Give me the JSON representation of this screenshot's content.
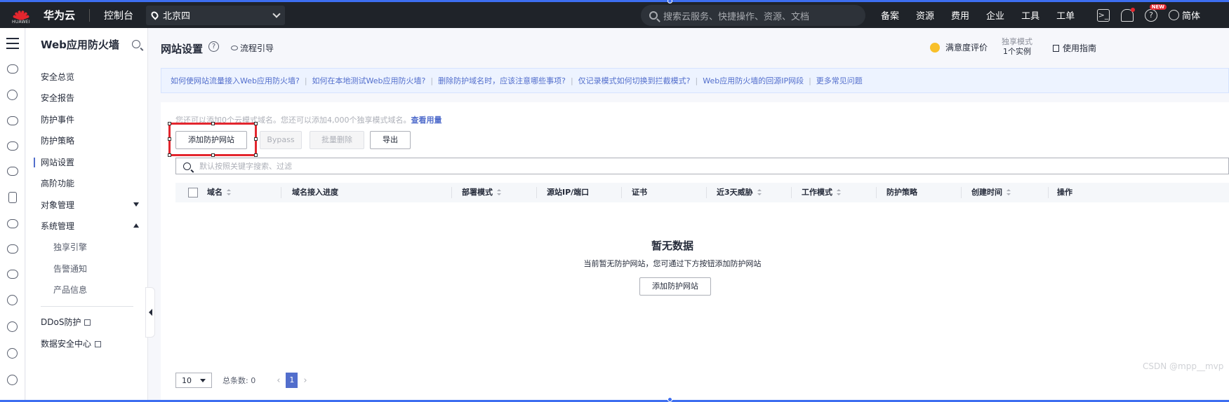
{
  "topbar": {
    "logo_small": "HUAWEI",
    "brand": "华为云",
    "console": "控制台",
    "region": "北京四",
    "search_placeholder": "搜索云服务、快捷操作、资源、文档",
    "nav": [
      "备案",
      "资源",
      "费用",
      "企业",
      "工具",
      "工单"
    ],
    "new_badge": "NEW",
    "help_glyph": "?",
    "language": "简体"
  },
  "sidebar": {
    "title": "Web应用防火墙",
    "items": [
      {
        "label": "安全总览"
      },
      {
        "label": "安全报告"
      },
      {
        "label": "防护事件"
      },
      {
        "label": "防护策略"
      },
      {
        "label": "网站设置"
      },
      {
        "label": "高阶功能"
      },
      {
        "label": "对象管理"
      },
      {
        "label": "系统管理"
      }
    ],
    "subitems": [
      {
        "label": "独享引擎"
      },
      {
        "label": "告警通知"
      },
      {
        "label": "产品信息"
      }
    ],
    "links": [
      {
        "label": "DDoS防护"
      },
      {
        "label": "数据安全中心"
      }
    ]
  },
  "header": {
    "title": "网站设置",
    "help_glyph": "?",
    "flow_guide": "流程引导",
    "rate": "满意度评价",
    "dedicated_mode": "独享模式",
    "instance_count": "1个实例",
    "usage_guide": "使用指南"
  },
  "faq": [
    "如何使网站流量接入Web应用防火墙?",
    "如何在本地测试Web应用防火墙?",
    "删除防护域名时，应该注意哪些事项?",
    "仅记录模式如何切换到拦截模式?",
    "Web应用防火墙的回源IP网段",
    "更多常见问题"
  ],
  "faq_separator": "|",
  "toolbar": {
    "quota_text": "您还可以添加0个云模式域名。您还可以添加4,000个独享模式域名。",
    "quota_link": "查看用量",
    "add_button": "添加防护网站",
    "bypass_button": "Bypass",
    "batch_delete_button": "批量删除",
    "export_button": "导出",
    "search_placeholder": "默认按照关键字搜索、过滤"
  },
  "table": {
    "columns": [
      {
        "label": "域名",
        "sortable": true
      },
      {
        "label": "域名接入进度",
        "sortable": false
      },
      {
        "label": "部署模式",
        "sortable": true
      },
      {
        "label": "源站IP/端口",
        "sortable": false
      },
      {
        "label": "证书",
        "sortable": false
      },
      {
        "label": "近3天威胁",
        "sortable": true
      },
      {
        "label": "工作模式",
        "sortable": true
      },
      {
        "label": "防护策略",
        "sortable": false
      },
      {
        "label": "创建时间",
        "sortable": true
      },
      {
        "label": "操作",
        "sortable": false
      }
    ],
    "rows": [],
    "empty_title": "暂无数据",
    "empty_desc": "当前暂无防护网站，您可通过下方按钮添加防护网站",
    "empty_button": "添加防护网站"
  },
  "pagination": {
    "page_size": "10",
    "total_label": "总条数: 0",
    "current_page": "1",
    "prev": "‹",
    "next": "›"
  },
  "watermark": "CSDN @mpp__mvp",
  "colors": {
    "topbar": "#1f2329",
    "accent": "#526ecc",
    "highlight": "#e3262e",
    "faq_bg": "#edf3ff"
  }
}
